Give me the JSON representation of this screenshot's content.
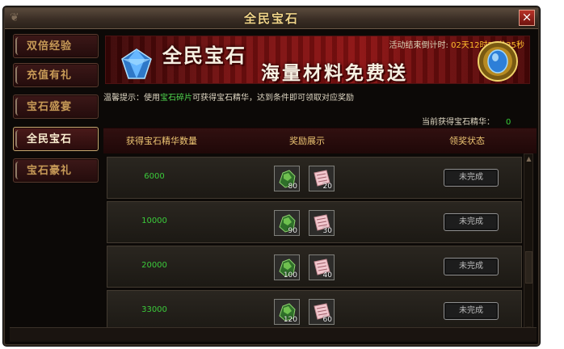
{
  "window": {
    "title": "全民宝石",
    "close_label": "×"
  },
  "sidebar": {
    "items": [
      {
        "label": "双倍经验",
        "active": false
      },
      {
        "label": "充值有礼",
        "active": false
      },
      {
        "label": "宝石盛宴",
        "active": false
      },
      {
        "label": "全民宝石",
        "active": true
      },
      {
        "label": "宝石豪礼",
        "active": false
      }
    ]
  },
  "banner": {
    "title": "全民宝石",
    "slogan": "海量材料免费送",
    "countdown_label": "活动结束倒计时:",
    "countdown_value": "02天12时25分35秒"
  },
  "tip": {
    "prefix": "温馨提示：使用",
    "highlight": "宝石碎片",
    "suffix": "可获得宝石精华，达到条件即可领取对应奖励"
  },
  "gain": {
    "label": "当前获得宝石精华：",
    "value": "0"
  },
  "table": {
    "headers": [
      "获得宝石精华数量",
      "奖励展示",
      "领奖状态"
    ],
    "rows": [
      {
        "amount": "6000",
        "item1_qty": "80",
        "item2_qty": "20",
        "status": "未完成"
      },
      {
        "amount": "10000",
        "item1_qty": "90",
        "item2_qty": "30",
        "status": "未完成"
      },
      {
        "amount": "20000",
        "item1_qty": "100",
        "item2_qty": "40",
        "status": "未完成"
      },
      {
        "amount": "33000",
        "item1_qty": "120",
        "item2_qty": "60",
        "status": "未完成"
      }
    ]
  },
  "icons": {
    "item1": "green-ore-icon",
    "item2": "pink-scroll-icon",
    "banner_left": "blue-gem-icon",
    "banner_right": "golden-gem-ornament-icon"
  },
  "colors": {
    "accent_gold": "#eec673",
    "status_green": "#3bcb3b",
    "countdown_orange": "#ffbf2a",
    "banner_red": "#8d1212"
  }
}
